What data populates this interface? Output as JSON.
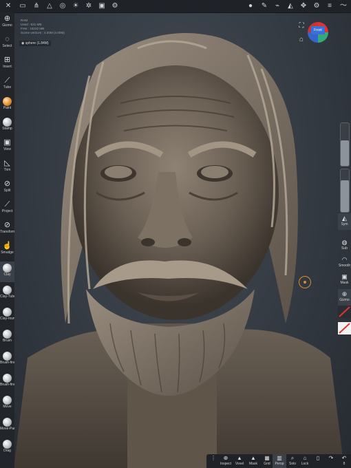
{
  "stats": {
    "ram": "RAM",
    "used": "Used : 621 MB",
    "free": "Free : 15222 MB",
    "vertices": "Scene vertices : 4.00M (4.00M)"
  },
  "mesh_chip": "sphere (1.84M)",
  "view_cube": {
    "label": "Front"
  },
  "left_tools": [
    {
      "label": "Gizmo",
      "icon": "gizmo-icon"
    },
    {
      "label": "Select",
      "icon": "lasso-icon"
    },
    {
      "label": "Insert",
      "icon": "insert-icon"
    },
    {
      "label": "Tube",
      "icon": "tube-icon"
    },
    {
      "label": "Paint",
      "icon": "paint-icon"
    },
    {
      "label": "Stamp",
      "icon": "stamp-icon"
    },
    {
      "label": "View",
      "icon": "camera-icon"
    },
    {
      "label": "Trim",
      "icon": "trim-icon"
    },
    {
      "label": "Split",
      "icon": "split-icon"
    },
    {
      "label": "Project",
      "icon": "project-icon"
    },
    {
      "label": "Transform",
      "icon": "transform-icon"
    },
    {
      "label": "Smudge",
      "icon": "smudge-icon"
    },
    {
      "label": "Clay",
      "icon": "brush-ball-icon"
    },
    {
      "label": "Clay-Tube",
      "icon": "brush-ball-icon"
    },
    {
      "label": "Clay-round",
      "icon": "brush-ball-icon"
    },
    {
      "label": "Brush",
      "icon": "brush-ball-icon"
    },
    {
      "label": "Brush-fine",
      "icon": "brush-ball-icon"
    },
    {
      "label": "Brush-fine2",
      "icon": "brush-ball-icon"
    },
    {
      "label": "Move",
      "icon": "brush-ball-icon"
    },
    {
      "label": "Move-Part",
      "icon": "brush-ball-icon"
    },
    {
      "label": "Drag",
      "icon": "brush-ball-icon"
    }
  ],
  "right_tools": [
    {
      "label": "Sym",
      "icon": "symmetry-icon"
    },
    {
      "label": "Sub",
      "icon": "sub-icon"
    },
    {
      "label": "Smooth",
      "icon": "smooth-icon"
    },
    {
      "label": "Mask",
      "icon": "mask-icon"
    },
    {
      "label": "Gizmo",
      "icon": "gizmo-icon"
    }
  ],
  "sliders": {
    "radius_level": 0.6,
    "intensity_level": 0.75
  },
  "bottom_tools": [
    {
      "label": "",
      "icon": "menu-icon"
    },
    {
      "label": "Inspect",
      "icon": "inspect-icon"
    },
    {
      "label": "Voxel",
      "icon": "voxel-icon"
    },
    {
      "label": "Mask",
      "icon": "mask-icon"
    },
    {
      "label": "Grid",
      "icon": "grid-icon"
    },
    {
      "label": "Persp",
      "icon": "perspective-icon"
    },
    {
      "label": "Solo",
      "icon": "solo-icon"
    },
    {
      "label": "Lock",
      "icon": "lock-icon"
    },
    {
      "label": "",
      "icon": "layers-icon"
    },
    {
      "label": "",
      "icon": "redo-icon"
    },
    {
      "label": "8",
      "icon": "undo-icon"
    }
  ],
  "colors": {
    "accent": "#e08a2a",
    "toolbar": "#22262b",
    "active": "#3b4148"
  }
}
